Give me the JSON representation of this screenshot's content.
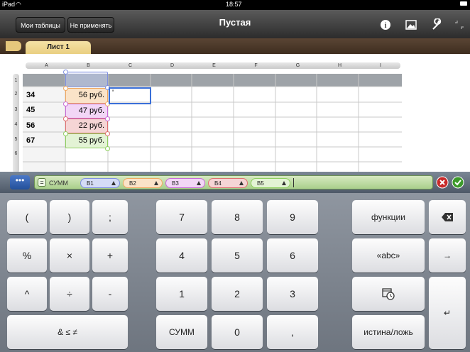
{
  "status": {
    "device": "iPad",
    "time": "18:57"
  },
  "toolbar": {
    "my_tables": "Мои таблицы",
    "dont_apply": "Не применять",
    "title": "Пустая"
  },
  "sheet_tab": {
    "label": "Лист 1"
  },
  "columns": [
    "A",
    "B",
    "C",
    "D",
    "E",
    "F",
    "G",
    "H",
    "I"
  ],
  "rows": [
    "1",
    "2",
    "3",
    "4",
    "5",
    "6"
  ],
  "cells": {
    "a2": "34",
    "a3": "45",
    "a4": "56",
    "a5": "67",
    "b2": "56 руб.",
    "b3": "47 руб.",
    "b4": "22 руб.",
    "b5": "55 руб.",
    "c2": "'"
  },
  "formula": {
    "func": "СУММ",
    "refs": [
      "B1",
      "B2",
      "B3",
      "B4",
      "B5"
    ]
  },
  "keyboard": {
    "row1": [
      "(",
      ")",
      ";",
      "7",
      "8",
      "9",
      "функции"
    ],
    "row2": [
      "%",
      "×",
      "+",
      "4",
      "5",
      "6",
      "«abc»",
      "→"
    ],
    "row3": [
      "^",
      "÷",
      "-",
      "1",
      "2",
      "3"
    ],
    "row4": [
      "& ≤ ≠",
      "СУММ",
      "0",
      ",",
      "истина/ложь",
      "↵"
    ]
  },
  "colors": {
    "b1": "#7f8fe0",
    "b2": "#f0a860",
    "b3": "#c86ad8",
    "b4": "#e07070",
    "b5": "#8fcf60"
  }
}
